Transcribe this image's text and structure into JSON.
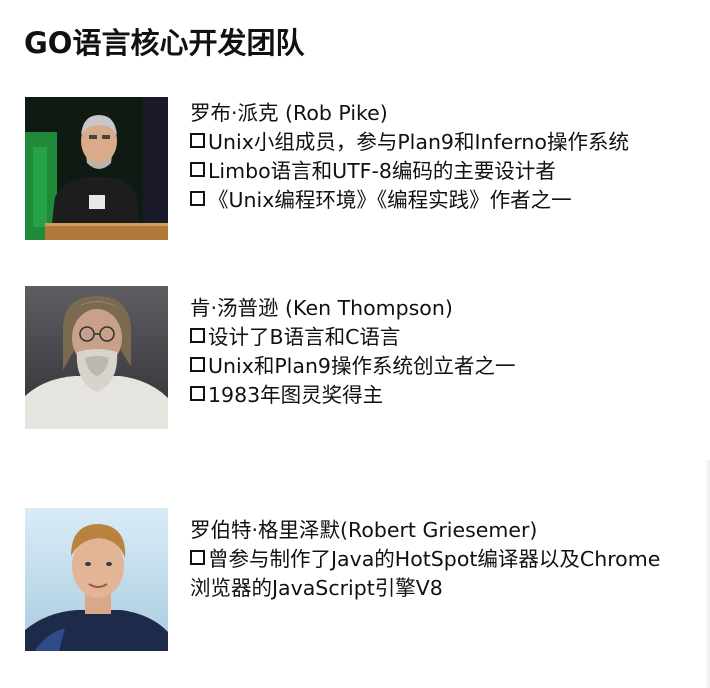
{
  "title": "GO语言核心开发团队",
  "people": [
    {
      "name": "罗布·派克 (Rob Pike)",
      "items": [
        "Unix小组成员，参与Plan9和Inferno操作系统",
        "Limbo语言和UTF-8编码的主要设计者",
        "《Unix编程环境》《编程实践》作者之一"
      ]
    },
    {
      "name": "肯·汤普逊 (Ken Thompson)",
      "items": [
        "设计了B语言和C语言",
        "Unix和Plan9操作系统创立者之一",
        "1983年图灵奖得主"
      ]
    },
    {
      "name": "罗伯特·格里泽默(Robert Griesemer)",
      "items": [
        "曾参与制作了Java的HotSpot编译器以及Chrome浏览器的JavaScript引擎V8"
      ]
    }
  ]
}
